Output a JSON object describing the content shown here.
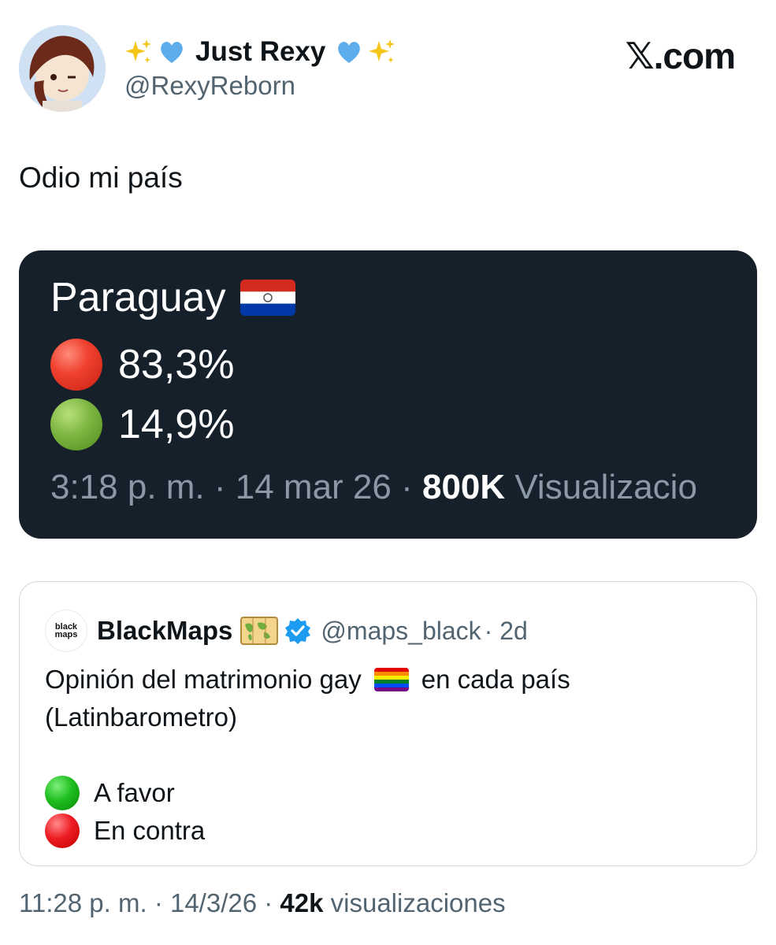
{
  "author": {
    "display_name": "Just Rexy",
    "handle": "@RexyReborn",
    "name_decorations": [
      "sparkles-icon",
      "blue-heart-icon",
      "blue-heart-icon",
      "sparkles-icon"
    ]
  },
  "brand": {
    "label": ".com",
    "glyph": "𝕏"
  },
  "tweet": {
    "text": "Odio mi país"
  },
  "media": {
    "country": "Paraguay",
    "red_value": "83,3%",
    "green_value": "14,9%",
    "meta_time": "3:18 p. m. · 14 mar 26 · ",
    "meta_views": "800K",
    "meta_views_label": " Visualizacio"
  },
  "quote": {
    "name": "BlackMaps",
    "avatar_text_1": "black",
    "avatar_text_2": "maps",
    "handle": "@maps_black",
    "age": "· 2d",
    "text_1": "Opinión del matrimonio gay",
    "text_1b": "en cada país",
    "text_2": "(Latinbarometro)",
    "legend_green": "A favor",
    "legend_red": "En contra"
  },
  "footer": {
    "time": "11:28 p. m. · 14/3/26 · ",
    "views": "42k",
    "views_label": " visualizaciones"
  },
  "colors": {
    "media_bg": "#15202b",
    "muted_text": "#536471",
    "border": "#cfd9de",
    "verified": "#1d9bf0"
  }
}
